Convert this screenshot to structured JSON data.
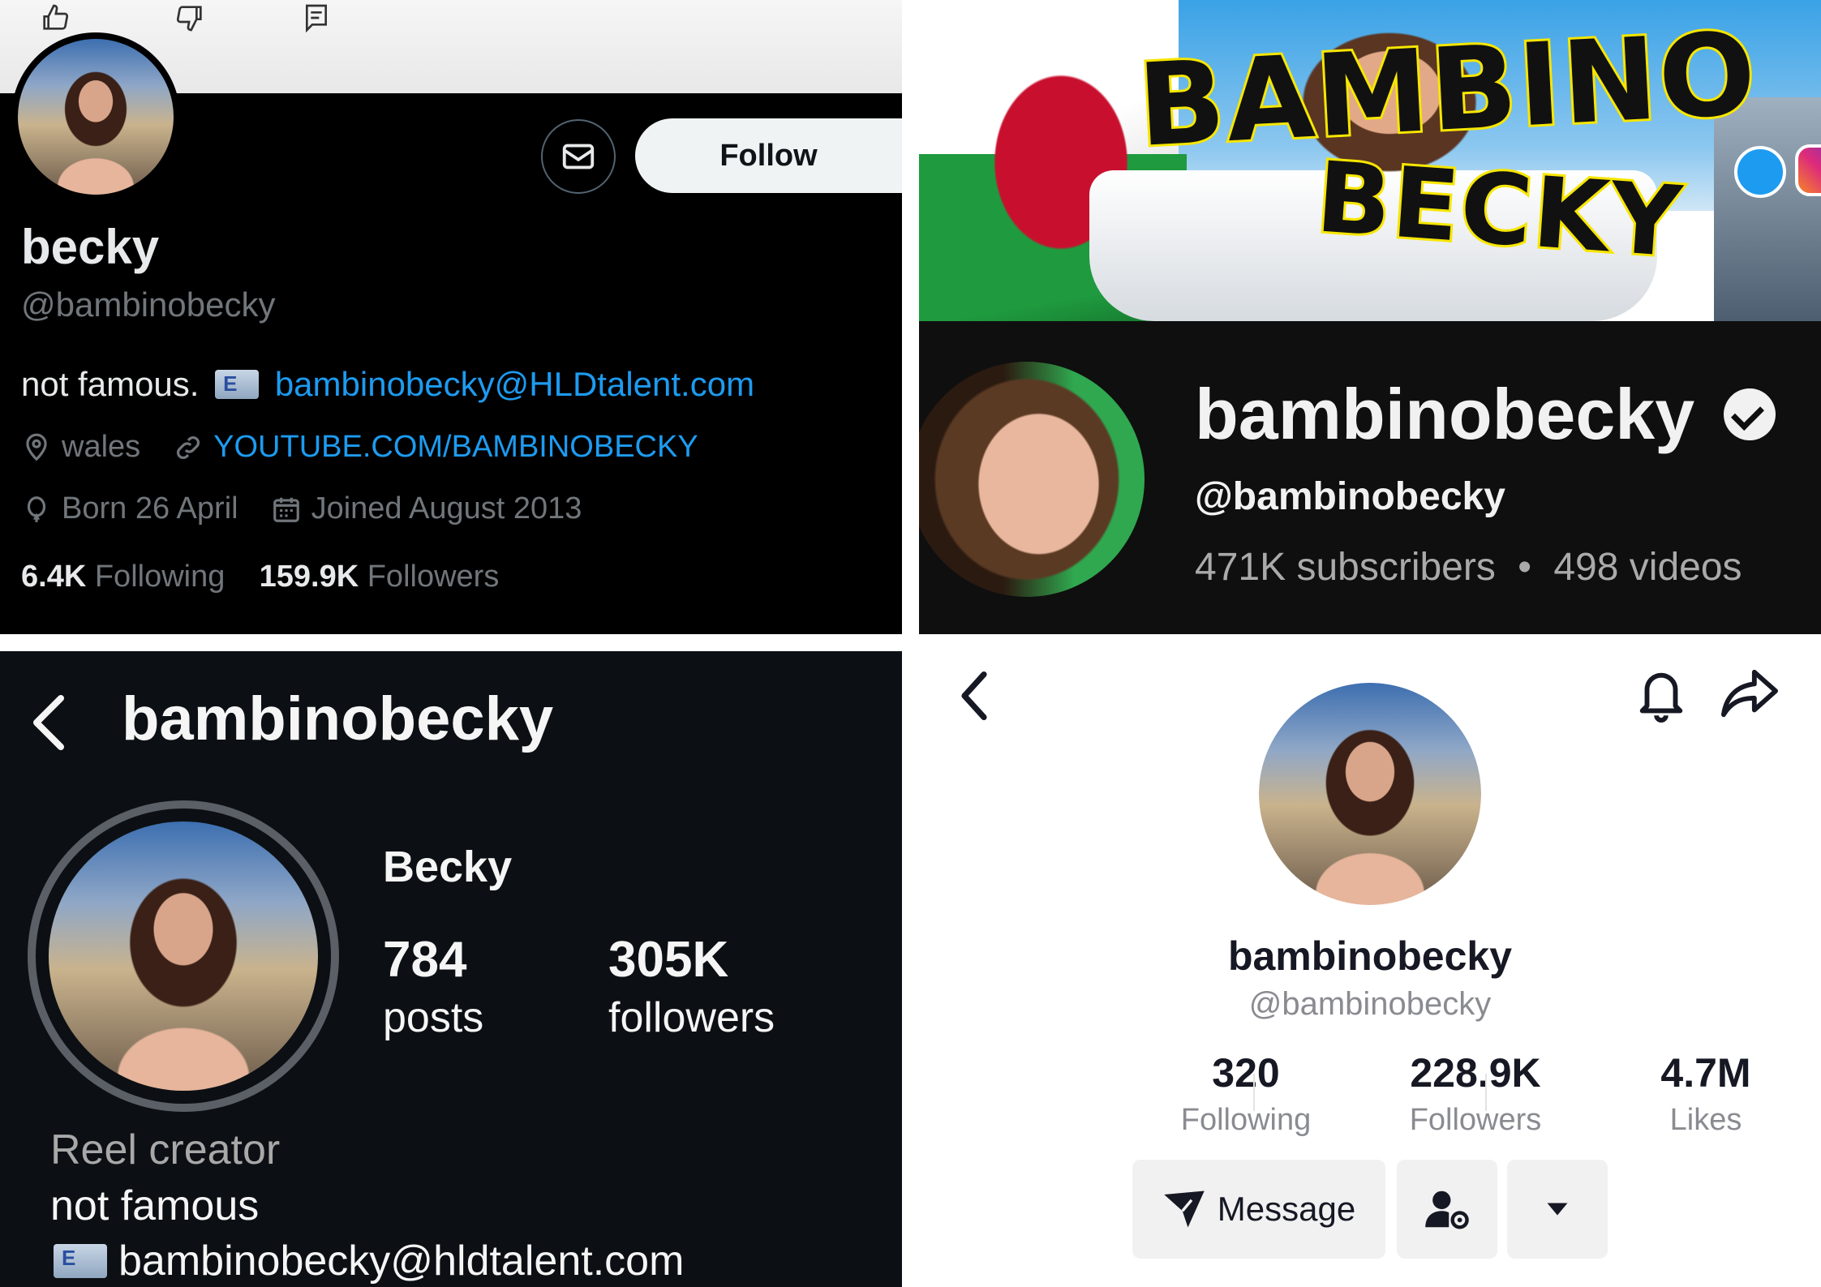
{
  "twitter": {
    "toolbar_icons": [
      "thumbs-up-icon",
      "thumbs-down-icon",
      "feedback-icon"
    ],
    "follow_label": "Follow",
    "display_name": "becky",
    "handle": "@bambinobecky",
    "bio_text": "not famous.",
    "bio_email": "bambinobecky@HLDtalent.com",
    "location": "wales",
    "website": "YOUTUBE.COM/BAMBINOBECKY",
    "birthday": "Born 26 April",
    "joined": "Joined August 2013",
    "following_count": "6.4K",
    "following_label": "Following",
    "followers_count": "159.9K",
    "followers_label": "Followers",
    "colors": {
      "link": "#1d9bf0",
      "background": "#000000"
    }
  },
  "youtube": {
    "banner_text_1": "BAMBINO",
    "banner_text_2": "BECKY",
    "channel_name": "bambinobecky",
    "handle": "@bambinobecky",
    "subscribers": "471K subscribers",
    "separator": "•",
    "videos": "498 videos",
    "icons": [
      "verified-icon",
      "twitter-icon",
      "instagram-icon"
    ]
  },
  "instagram": {
    "username": "bambinobecky",
    "full_name": "Becky",
    "posts_count": "784",
    "posts_label": "posts",
    "followers_count": "305K",
    "followers_label": "followers",
    "category": "Reel creator",
    "bio": "not famous",
    "email": "bambinobecky@hldtalent.com"
  },
  "tiktok": {
    "username": "bambinobecky",
    "handle": "@bambinobecky",
    "following_count": "320",
    "following_label": "Following",
    "followers_count": "228.9K",
    "followers_label": "Followers",
    "likes_count": "4.7M",
    "likes_label": "Likes",
    "message_label": "Message",
    "icons": [
      "back-icon",
      "bell-icon",
      "share-icon",
      "send-icon",
      "add-friend-icon",
      "dropdown-arrow-icon"
    ]
  }
}
